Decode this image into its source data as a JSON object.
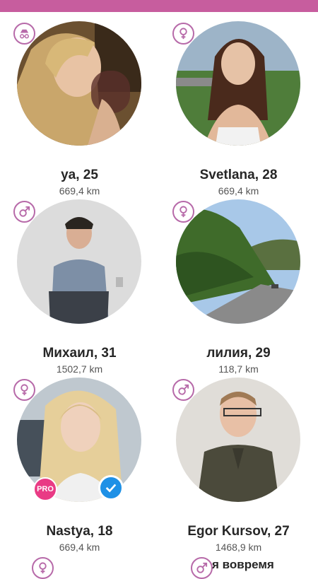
{
  "colors": {
    "accent": "#c75d9e",
    "pro_badge": "#e93b85",
    "verified": "#1e90e6"
  },
  "profiles": [
    {
      "name": "ya, 25",
      "distance": "669,4 km",
      "gender_icon": "incognito-icon"
    },
    {
      "name": "Svetlana, 28",
      "distance": "669,4 km",
      "gender_icon": "female-icon"
    },
    {
      "name": "Михаил, 31",
      "distance": "1502,7 km",
      "gender_icon": "male-icon"
    },
    {
      "name": "лилия, 29",
      "distance": "118,7 km",
      "gender_icon": "female-icon"
    },
    {
      "name": "Nastya, 18",
      "distance": "669,4 km",
      "gender_icon": "female-icon",
      "pro_label": "PRO",
      "verified": true
    },
    {
      "name": "Egor Kursov, 27",
      "distance": "1468,9 km",
      "gender_icon": "male-icon"
    }
  ],
  "partial_profiles": [
    {
      "gender_icon": "female-icon"
    },
    {
      "gender_icon": "male-icon",
      "name": "я вовремя"
    }
  ]
}
